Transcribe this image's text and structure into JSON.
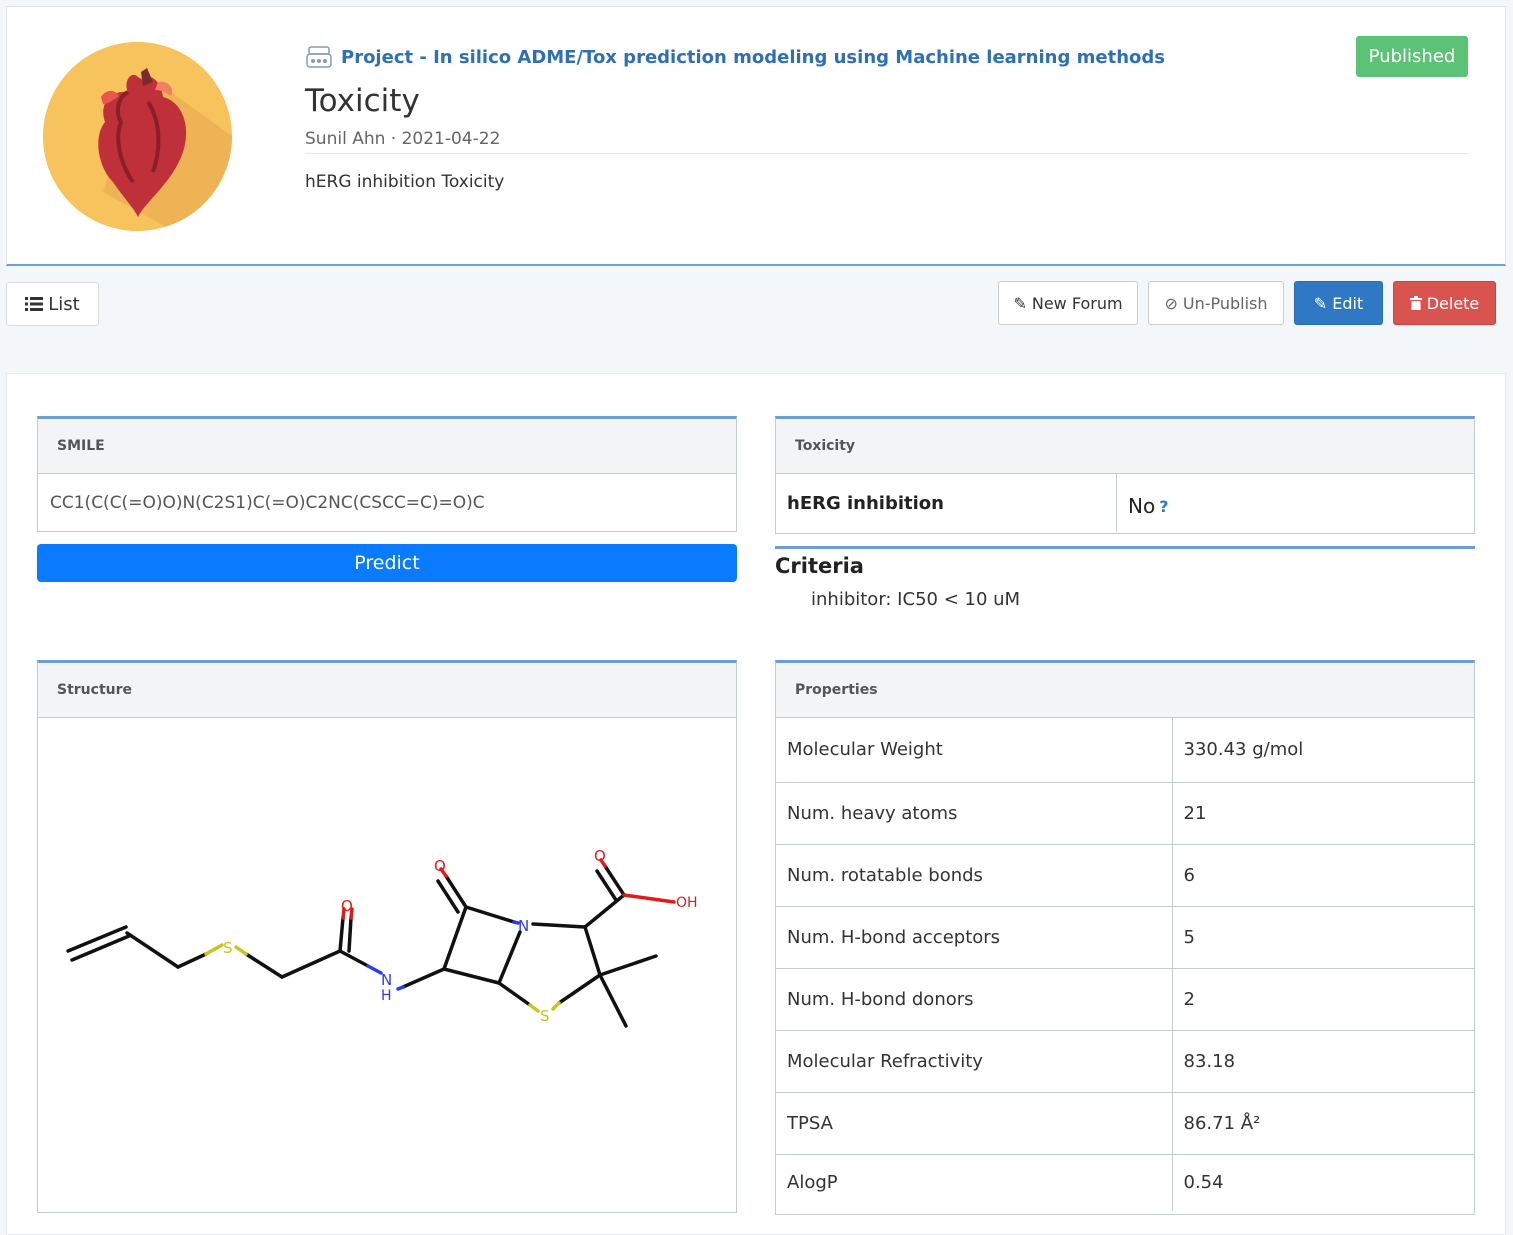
{
  "header": {
    "project_link": "Project - In silico ADME/Tox prediction modeling using Machine learning methods",
    "title": "Toxicity",
    "author": "Sunil Ahn",
    "separator": "·",
    "date": "2021-04-22",
    "description": "hERG inhibition Toxicity",
    "status_badge": "Published"
  },
  "toolbar": {
    "list_label": "List",
    "new_forum_label": "New Forum",
    "unpublish_label": "Un-Publish",
    "edit_label": "Edit",
    "delete_label": "Delete"
  },
  "smile_panel": {
    "heading": "SMILE",
    "value": "CC1(C(C(=O)O)N(C2S1)C(=O)C2NC(CSCC=C)=O)C",
    "predict_label": "Predict"
  },
  "toxicity_panel": {
    "heading": "Toxicity",
    "label": "hERG inhibition",
    "value": "No",
    "help_icon": "?"
  },
  "criteria": {
    "title": "Criteria",
    "text": "inhibitor: IC50 < 10 uM"
  },
  "structure_panel": {
    "heading": "Structure",
    "atoms": {
      "oxygen": "O",
      "oh": "OH",
      "nitrogen": "N",
      "nh": "H",
      "sulfur": "S"
    }
  },
  "properties_panel": {
    "heading": "Properties",
    "rows": [
      {
        "label": "Molecular Weight",
        "value": "330.43 g/mol"
      },
      {
        "label": "Num. heavy atoms",
        "value": "21"
      },
      {
        "label": "Num. rotatable bonds",
        "value": "6"
      },
      {
        "label": "Num. H-bond acceptors",
        "value": "5"
      },
      {
        "label": "Num. H-bond donors",
        "value": "2"
      },
      {
        "label": "Molecular Refractivity",
        "value": "83.18"
      },
      {
        "label": "TPSA",
        "value": "86.71 Å²"
      },
      {
        "label": "AlogP",
        "value": "0.54"
      }
    ]
  },
  "colors": {
    "accent": "#2f6fb3",
    "published": "#5cc275",
    "predict": "#0a7bff",
    "edit": "#2f78c4",
    "delete": "#d9534f",
    "panel_top": "#6a9ed4"
  }
}
